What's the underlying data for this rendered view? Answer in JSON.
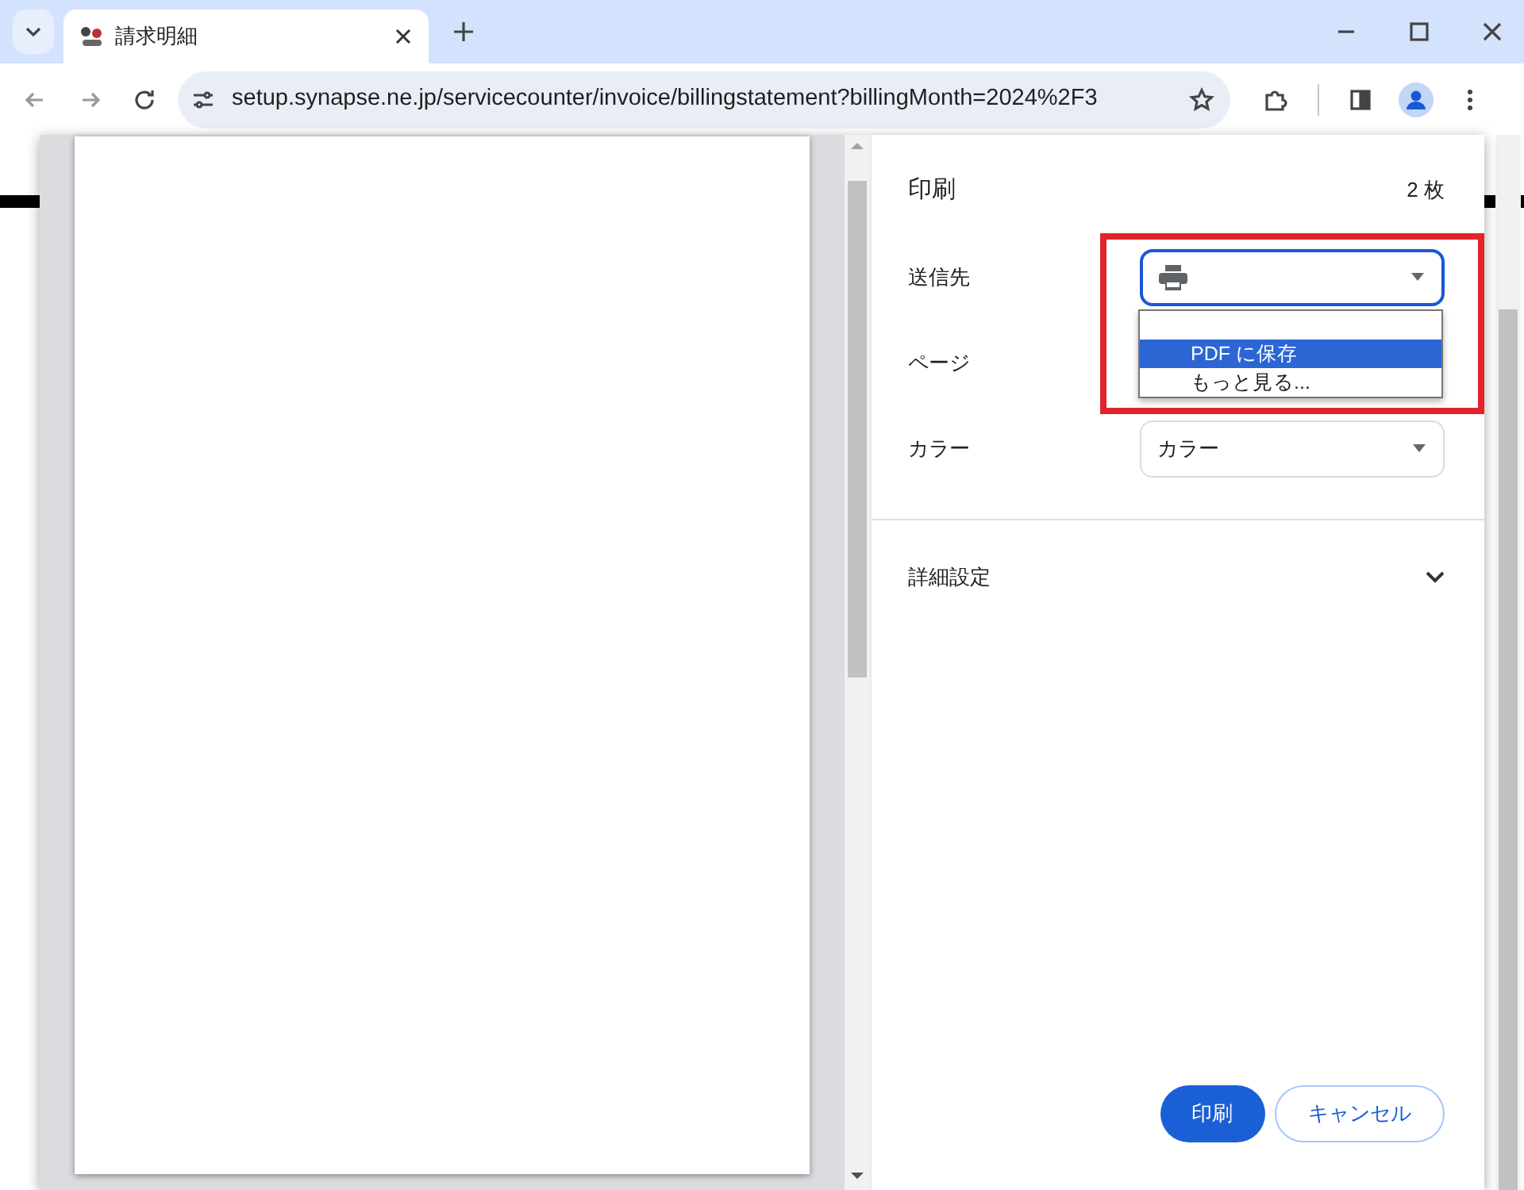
{
  "browser": {
    "tab_title": "請求明細",
    "url": "setup.synapse.ne.jp/servicecounter/invoice/billingstatement?billingMonth=2024%2F3"
  },
  "print_dialog": {
    "title": "印刷",
    "sheet_count": "2 枚",
    "settings": [
      {
        "label": "送信先",
        "kind": "destination",
        "highlighted": true
      },
      {
        "label": "ページ",
        "kind": "hidden"
      },
      {
        "label": "カラー",
        "kind": "select",
        "value": "カラー"
      }
    ],
    "destination_menu": {
      "expanded": true,
      "options": [
        {
          "label": "PDF に保存",
          "selected": true
        },
        {
          "label": "もっと見る...",
          "selected": false
        }
      ]
    },
    "advanced": {
      "label": "詳細設定",
      "expanded": false
    },
    "buttons": [
      {
        "label": "印刷",
        "kind": "primary"
      },
      {
        "label": "キャンセル",
        "kind": "secondary"
      }
    ]
  }
}
